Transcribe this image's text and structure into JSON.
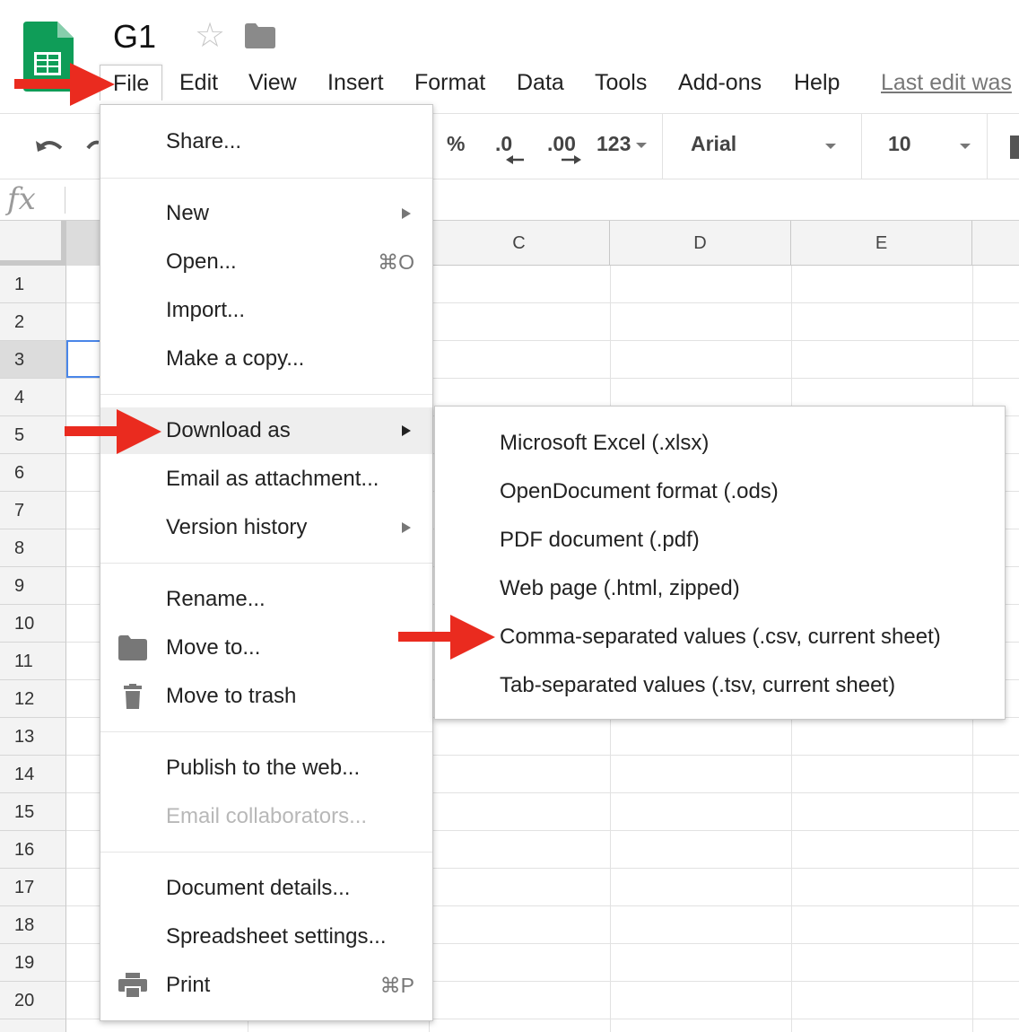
{
  "app": {
    "doc_title": "G1",
    "logo_icon": "google-sheets-logo",
    "star_icon": "star-outline-icon",
    "folder_icon": "folder-icon"
  },
  "menubar": {
    "items": [
      "File",
      "Edit",
      "View",
      "Insert",
      "Format",
      "Data",
      "Tools",
      "Add-ons",
      "Help"
    ],
    "last_edit": "Last edit was"
  },
  "toolbar": {
    "percent": "%",
    "decrease_decimal": ".0",
    "increase_decimal": ".00",
    "more_formats": "123",
    "font": "Arial",
    "font_size": "10"
  },
  "formula_bar": {
    "fx": "fx"
  },
  "grid": {
    "columns": [
      "C",
      "D",
      "E"
    ],
    "rows": [
      "1",
      "2",
      "3",
      "4",
      "5",
      "6",
      "7",
      "8",
      "9",
      "10",
      "11",
      "12",
      "13",
      "14",
      "15",
      "16",
      "17",
      "18",
      "19",
      "20"
    ],
    "selected_row": "3"
  },
  "file_menu": {
    "share": "Share...",
    "new": "New",
    "open": "Open...",
    "open_shortcut": "⌘O",
    "import": "Import...",
    "make_copy": "Make a copy...",
    "download_as": "Download as",
    "email_attachment": "Email as attachment...",
    "version_history": "Version history",
    "rename": "Rename...",
    "move_to": "Move to...",
    "move_to_trash": "Move to trash",
    "publish": "Publish to the web...",
    "email_collaborators": "Email collaborators...",
    "document_details": "Document details...",
    "spreadsheet_settings": "Spreadsheet settings...",
    "print": "Print",
    "print_shortcut": "⌘P"
  },
  "download_submenu": {
    "items": [
      "Microsoft Excel (.xlsx)",
      "OpenDocument format (.ods)",
      "PDF document (.pdf)",
      "Web page (.html, zipped)",
      "Comma-separated values (.csv, current sheet)",
      "Tab-separated values (.tsv, current sheet)"
    ]
  },
  "colors": {
    "sheets_green": "#0f9d58",
    "annotation_red": "#ea2b1f",
    "selection_blue": "#4a86e8"
  }
}
